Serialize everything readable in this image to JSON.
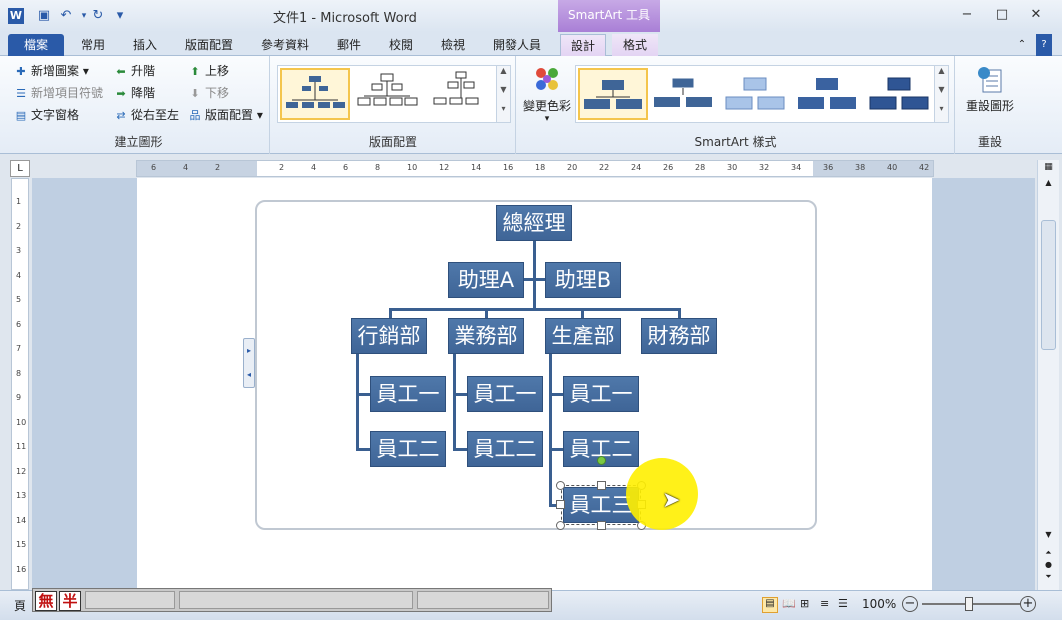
{
  "window": {
    "title": "文件1 - Microsoft Word",
    "context_tab": "SmartArt 工具",
    "buttons": {
      "minimize": "−",
      "maximize": "□",
      "close": "✕"
    }
  },
  "quick_access": {
    "word_icon": "W",
    "save": "💾",
    "undo": "↶",
    "redo": "↻",
    "more": "▾"
  },
  "tabs": [
    {
      "label": "檔案"
    },
    {
      "label": "常用"
    },
    {
      "label": "插入"
    },
    {
      "label": "版面配置"
    },
    {
      "label": "參考資料"
    },
    {
      "label": "郵件"
    },
    {
      "label": "校閱"
    },
    {
      "label": "檢視"
    },
    {
      "label": "開發人員"
    },
    {
      "label": "設計"
    },
    {
      "label": "格式"
    }
  ],
  "ribbon": {
    "create_graphic": {
      "label": "建立圖形",
      "add_shape": "新增圖案",
      "add_bullet": "新增項目符號",
      "text_pane": "文字窗格",
      "promote": "升階",
      "demote": "降階",
      "right_to_left": "從右至左",
      "move_up": "上移",
      "move_down": "下移",
      "layout": "版面配置"
    },
    "layouts": {
      "label": "版面配置"
    },
    "change_colors": "變更色彩",
    "smartart_styles": {
      "label": "SmartArt 樣式"
    },
    "reset": {
      "label": "重設",
      "reset_graphic": "重設圖形"
    }
  },
  "ruler_ticks": [
    "6",
    "4",
    "2",
    "",
    "2",
    "4",
    "6",
    "8",
    "10",
    "12",
    "14",
    "16",
    "18",
    "20",
    "22",
    "24",
    "26",
    "28",
    "30",
    "32",
    "34",
    "36",
    "38",
    "40",
    "42"
  ],
  "vruler_ticks": [
    "1",
    "2",
    "3",
    "4",
    "5",
    "6",
    "7",
    "8",
    "9",
    "10",
    "11",
    "12",
    "13",
    "14",
    "15",
    "16"
  ],
  "smartart": {
    "ceo": "總經理",
    "assistants": [
      "助理A",
      "助理B"
    ],
    "departments": [
      "行銷部",
      "業務部",
      "生產部",
      "財務部"
    ],
    "staff": {
      "marketing": [
        "員工一",
        "員工二"
      ],
      "sales": [
        "員工一",
        "員工二"
      ],
      "production": [
        "員工一",
        "員工二",
        "員工三"
      ]
    }
  },
  "status": {
    "page": "頁",
    "ime_mode": "無",
    "ime_width": "半",
    "zoom": "100%",
    "zoom_out": "−",
    "zoom_in": "+"
  }
}
